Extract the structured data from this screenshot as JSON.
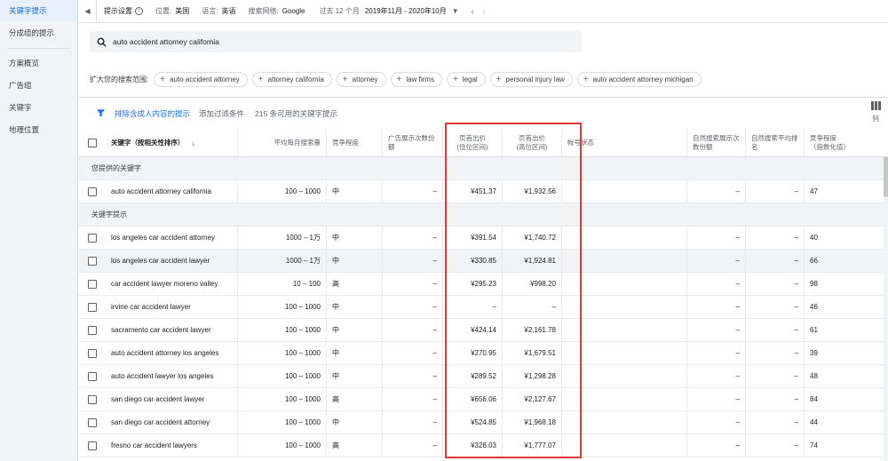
{
  "sidebar": {
    "items": [
      {
        "label": "关键字提示",
        "active": true
      },
      {
        "label": "分成组的提示",
        "active": false
      },
      {
        "label": "方案概览",
        "active": false
      },
      {
        "label": "广告组",
        "active": false
      },
      {
        "label": "关键字",
        "active": false
      },
      {
        "label": "地理位置",
        "active": false
      }
    ]
  },
  "topbar": {
    "collapse_icon": "◀",
    "title": "提示设置",
    "info_icon": "i",
    "location_key": "位置:",
    "location_value": "美国",
    "language_key": "语言:",
    "language_value": "英语",
    "network_key": "搜索网络:",
    "network_value": "Google",
    "period_label": "过去 12 个月",
    "range": "2019年11月 - 2020年10月",
    "caret": "▼",
    "prev": "‹",
    "next": "›"
  },
  "search": {
    "query": "auto accident attorney california"
  },
  "expand": {
    "label": "扩大您的搜索范围:",
    "chips": [
      "auto accident attorney",
      "attorney california",
      "attorney",
      "law firms",
      "legal",
      "personal injury law",
      "auto accident attorney michigan"
    ]
  },
  "filters": {
    "exclude_adult": "排除含成人内容的提示",
    "add_filter": "添加过滤条件",
    "count_text": "215 条可用的关键字提示",
    "columns_label": "列"
  },
  "table": {
    "headers": {
      "keyword": "关键字（按相关性排序）",
      "sort_arrow": "↓",
      "avg_searches": "平均每月搜索量",
      "competition": "竞争程度",
      "impression_share": "广告展示次数份额",
      "top_bid_low": "页首出价\n(低位区间)",
      "top_bid_high": "页首出价\n(高位区间)",
      "account_status": "帐号状态",
      "organic_impr": "自然搜索展示次数份额",
      "organic_pos": "自然搜索平均排名",
      "comp_index": "竞争程度\n（指数化值）"
    },
    "section_provided": "您提供的关键字",
    "section_ideas": "关键字提示",
    "provided_rows": [
      {
        "keyword": "auto accident attorney california",
        "avg": "100 – 1000",
        "comp": "中",
        "share": "–",
        "low": "¥451.37",
        "high": "¥1,932.56",
        "acct": "",
        "org": "–",
        "orgpos": "–",
        "idx": "47"
      }
    ],
    "idea_rows": [
      {
        "keyword": "los angeles car accident attorney",
        "avg": "1000 – 1万",
        "comp": "中",
        "share": "–",
        "low": "¥391.54",
        "high": "¥1,740.72",
        "acct": "",
        "org": "–",
        "orgpos": "–",
        "idx": "40"
      },
      {
        "keyword": "los angeles car accident lawyer",
        "avg": "1000 – 1万",
        "comp": "中",
        "share": "–",
        "low": "¥330.85",
        "high": "¥1,924.81",
        "acct": "",
        "org": "–",
        "orgpos": "–",
        "idx": "66"
      },
      {
        "keyword": "car accident lawyer moreno valley",
        "avg": "10 – 100",
        "comp": "高",
        "share": "–",
        "low": "¥295.23",
        "high": "¥998.20",
        "acct": "",
        "org": "–",
        "orgpos": "–",
        "idx": "98"
      },
      {
        "keyword": "irvine car accident lawyer",
        "avg": "100 – 1000",
        "comp": "中",
        "share": "–",
        "low": "–",
        "high": "–",
        "acct": "",
        "org": "–",
        "orgpos": "–",
        "idx": "46"
      },
      {
        "keyword": "sacramento car accident lawyer",
        "avg": "100 – 1000",
        "comp": "中",
        "share": "–",
        "low": "¥424.14",
        "high": "¥2,161.78",
        "acct": "",
        "org": "–",
        "orgpos": "–",
        "idx": "61"
      },
      {
        "keyword": "auto accident attorney los angeles",
        "avg": "100 – 1000",
        "comp": "中",
        "share": "–",
        "low": "¥270.95",
        "high": "¥1,679.51",
        "acct": "",
        "org": "–",
        "orgpos": "–",
        "idx": "39"
      },
      {
        "keyword": "auto accident lawyer los angeles",
        "avg": "100 – 1000",
        "comp": "中",
        "share": "–",
        "low": "¥289.52",
        "high": "¥1,298.28",
        "acct": "",
        "org": "–",
        "orgpos": "–",
        "idx": "48"
      },
      {
        "keyword": "san diego car accident lawyer",
        "avg": "100 – 1000",
        "comp": "高",
        "share": "–",
        "low": "¥656.06",
        "high": "¥2,127.67",
        "acct": "",
        "org": "–",
        "orgpos": "–",
        "idx": "84"
      },
      {
        "keyword": "san diego car accident attorney",
        "avg": "100 – 1000",
        "comp": "中",
        "share": "–",
        "low": "¥524.85",
        "high": "¥1,968.18",
        "acct": "",
        "org": "–",
        "orgpos": "–",
        "idx": "44"
      },
      {
        "keyword": "fresno car accident lawyers",
        "avg": "100 – 1000",
        "comp": "高",
        "share": "–",
        "low": "¥328.03",
        "high": "¥1,777.07",
        "acct": "",
        "org": "–",
        "orgpos": "–",
        "idx": "74"
      }
    ]
  },
  "colors": {
    "accent": "#1a73e8",
    "highlight": "#e53935",
    "sidebar_bg": "#f1f3f4"
  }
}
